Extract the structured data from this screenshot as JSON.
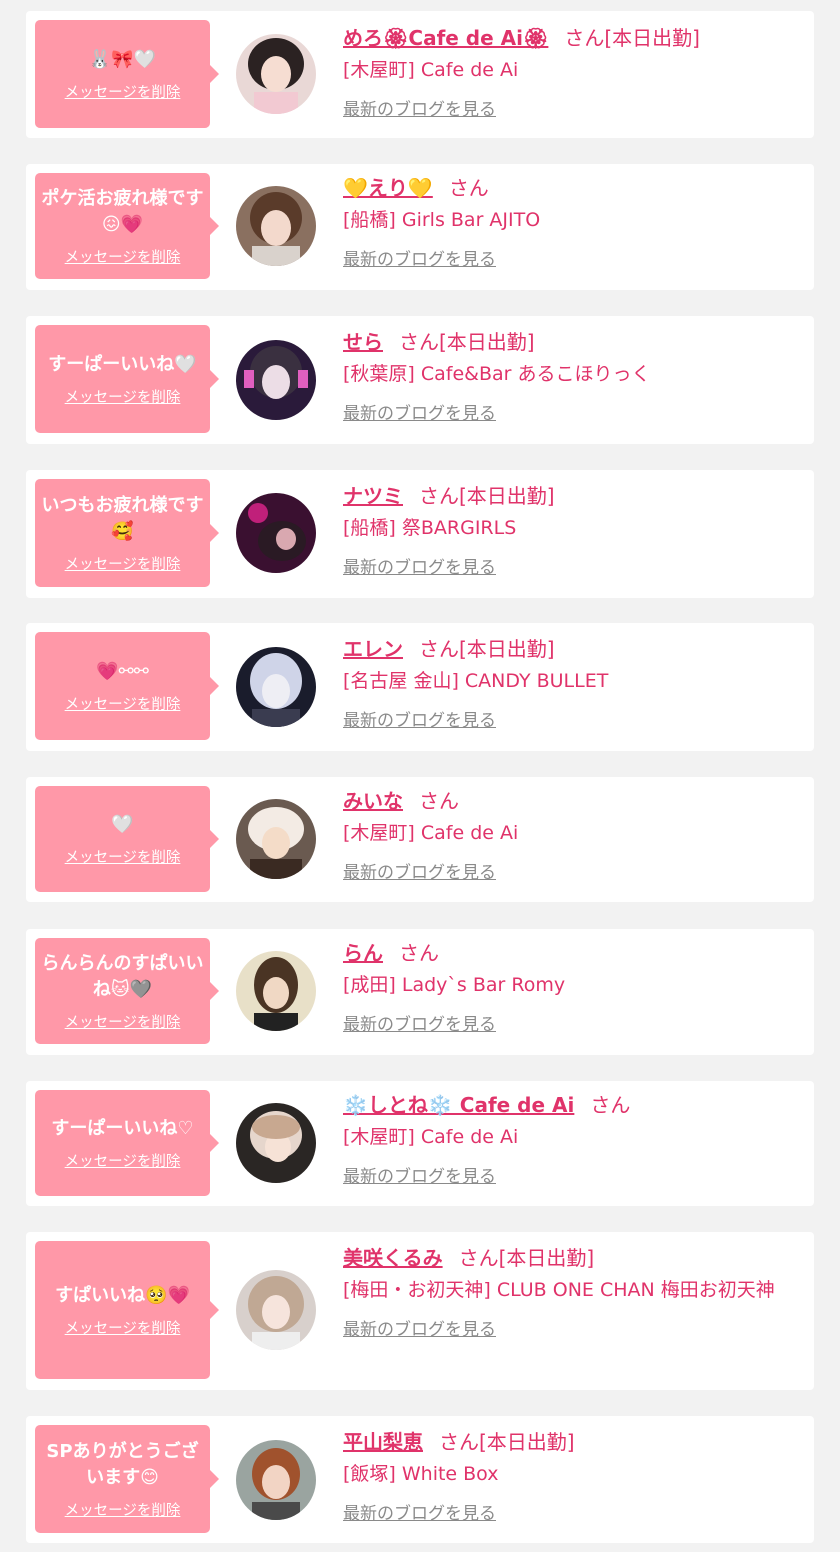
{
  "delete_label": "メッセージを削除",
  "blog_label": "最新のブログを見る",
  "san_label": "さん",
  "colors": {
    "bubble": "#ff98a8",
    "accent": "#e0336a",
    "link_gray": "#8a8a8a",
    "background": "#f2f2f2"
  },
  "items": [
    {
      "message": "🐰🎀🤍",
      "name": "めろ🏵Cafe de Ai🏵",
      "today": "[本日出勤]",
      "shop": "[木屋町] Cafe de Ai"
    },
    {
      "message": "ポケ活お疲れ様です😖💗",
      "name": "💛えり💛",
      "today": "",
      "shop": "[船橋] Girls Bar AJITO"
    },
    {
      "message": "すーぱーいいね🤍",
      "name": "せら",
      "today": "[本日出勤]",
      "shop": "[秋葉原] Cafe&Bar あるこほりっく"
    },
    {
      "message": "いつもお疲れ様です🥰",
      "name": "ナツミ",
      "today": "[本日出勤]",
      "shop": "[船橋] 祭BARGIRLS"
    },
    {
      "message": "💗⚯⚯",
      "name": "エレン",
      "today": "[本日出勤]",
      "shop": "[名古屋 金山] CANDY BULLET"
    },
    {
      "message": "🤍",
      "name": "みいな",
      "today": "",
      "shop": "[木屋町] Cafe de Ai"
    },
    {
      "message": "らんらんのすぱいいね🐱🩶",
      "name": "らん",
      "today": "",
      "shop": "[成田] Lady`s Bar Romy"
    },
    {
      "message": "すーぱーいいね♡",
      "name": "❄️しとね❄️ Cafe de Ai",
      "today": "",
      "shop": "[木屋町] Cafe de Ai"
    },
    {
      "message": "すぱいいね🥺💗",
      "name": "美咲くるみ",
      "today": "[本日出勤]",
      "shop": "[梅田・お初天神] CLUB ONE CHAN 梅田お初天神"
    },
    {
      "message": "SPありがとうございます😊",
      "name": "平山梨恵",
      "today": "[本日出勤]",
      "shop": "[飯塚] White Box"
    }
  ]
}
